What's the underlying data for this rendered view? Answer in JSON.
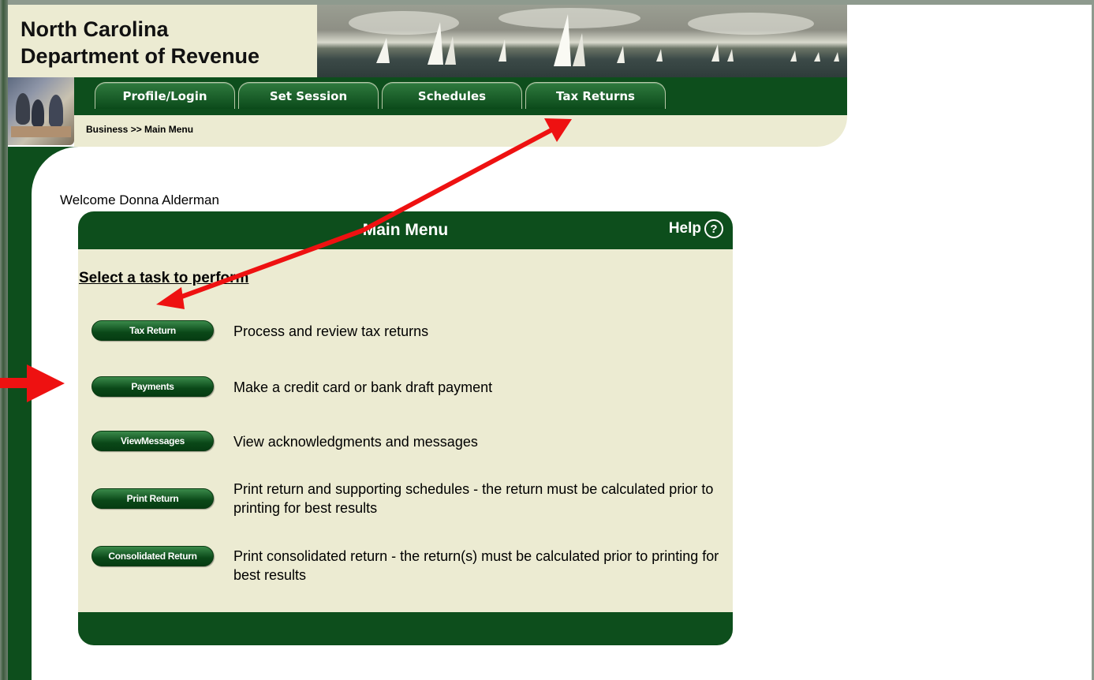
{
  "header": {
    "dept_line1": "North Carolina",
    "dept_line2": "Department of Revenue"
  },
  "nav": {
    "tabs": [
      {
        "label": "Profile/Login"
      },
      {
        "label": "Set Session"
      },
      {
        "label": "Schedules"
      },
      {
        "label": "Tax Returns"
      }
    ]
  },
  "breadcrumb": "Business >> Main Menu",
  "welcome": "Welcome Donna Alderman",
  "panel": {
    "title": "Main Menu",
    "help_label": "Help",
    "help_icon_glyph": "?",
    "task_heading": "Select a task to perform",
    "tasks": [
      {
        "button": "Tax Return",
        "description": "Process and review tax returns"
      },
      {
        "button": "Payments",
        "description": "Make a credit card or bank draft payment"
      },
      {
        "button": "ViewMessages",
        "description": "View acknowledgments and messages"
      },
      {
        "button": "Print Return",
        "description": "Print return and supporting schedules - the return must be calculated prior to printing for best results"
      },
      {
        "button": "Consolidated Return",
        "description": "Print consolidated return - the return(s) must be calculated prior to printing for best results"
      }
    ]
  },
  "colors": {
    "brand_green": "#0d4e1c",
    "panel_beige": "#ecebd2",
    "annotation_red": "#ee1111"
  },
  "icons": [
    "help-icon",
    "photo-image",
    "banner-image",
    "annotation-arrow"
  ]
}
